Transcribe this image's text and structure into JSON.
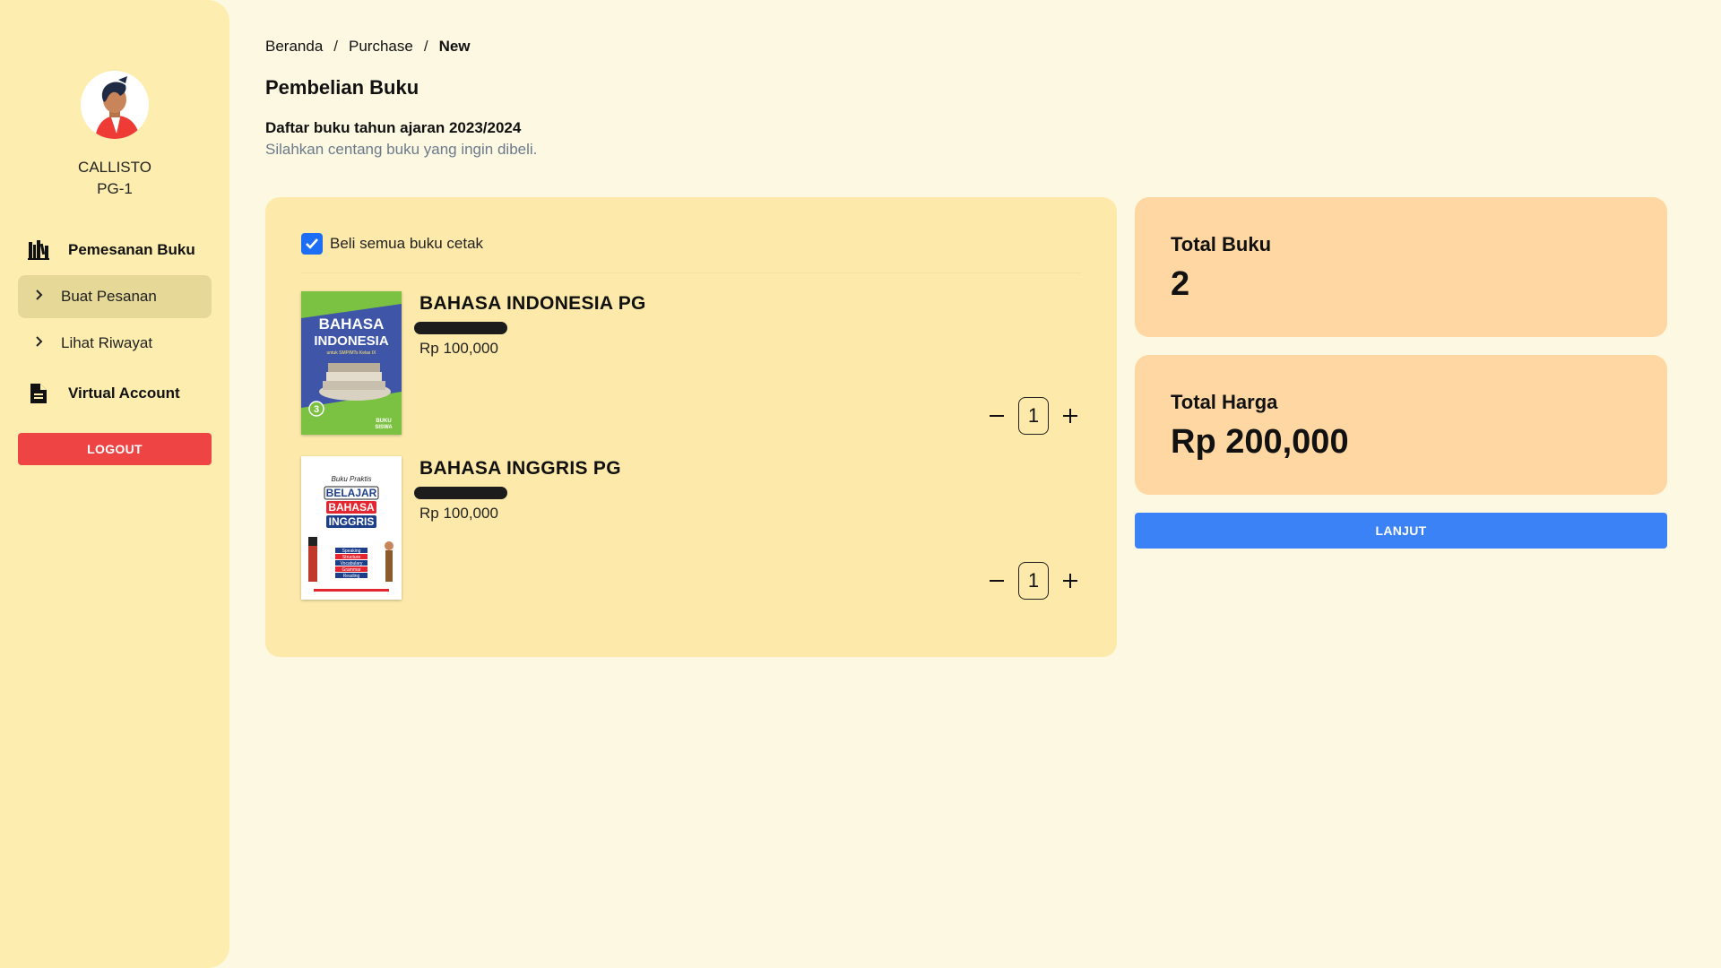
{
  "sidebar": {
    "user_name": "CALLISTO",
    "user_class": "PG-1",
    "section_order": "Pemesanan Buku",
    "items": [
      {
        "label": "Buat Pesanan",
        "active": true
      },
      {
        "label": "Lihat Riwayat",
        "active": false
      }
    ],
    "section_va": "Virtual Account",
    "logout_label": "LOGOUT"
  },
  "breadcrumb": {
    "items": [
      "Beranda",
      "Purchase",
      "New"
    ],
    "separator": "/"
  },
  "main": {
    "title": "Pembelian Buku",
    "subtitle": "Daftar buku tahun ajaran 2023/2024",
    "helper": "Silahkan centang buku yang ingin dibeli.",
    "select_all_label": "Beli semua buku cetak",
    "select_all_checked": true,
    "books": [
      {
        "title": "BAHASA INDONESIA PG",
        "price": "Rp 100,000",
        "qty": "1",
        "cover": {
          "line1": "BAHASA",
          "line2": "INDONESIA",
          "caption": "untuk SMP/MTs Kelas IX",
          "badge": "3",
          "tag_line1": "BUKU",
          "tag_line2": "SISWA"
        }
      },
      {
        "title": "BAHASA INGGRIS PG",
        "price": "Rp 100,000",
        "qty": "1",
        "cover": {
          "top": "Buku Praktis",
          "line1": "BELAJAR",
          "line2": "BAHASA",
          "line3": "INGGRIS",
          "tags": [
            "Speaking",
            "Structure",
            "Vocabulary",
            "Grammar",
            "Reading"
          ]
        }
      }
    ]
  },
  "summary": {
    "total_books_label": "Total Buku",
    "total_books_value": "2",
    "total_price_label": "Total Harga",
    "total_price_value": "Rp 200,000",
    "continue_label": "LANJUT"
  },
  "colors": {
    "page_bg": "#fdf8e1",
    "sidebar_bg": "#fdeeb0",
    "card_bg": "#fdeaaa",
    "summary_bg": "#fed7a3",
    "primary": "#3b82f6",
    "danger": "#ef4444",
    "checkbox": "#1d6ef5"
  },
  "icons": {
    "section_order": "books-icon",
    "section_va": "document-icon",
    "menu_chevron": "chevron-right-icon",
    "decrement": "minus-icon",
    "increment": "plus-icon"
  }
}
